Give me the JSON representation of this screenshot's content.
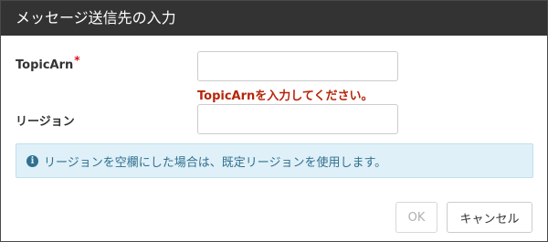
{
  "dialog": {
    "title": "メッセージ送信先の入力"
  },
  "form": {
    "topic_arn": {
      "label": "TopicArn",
      "required_mark": "*",
      "value": "",
      "error": "TopicArnを入力してください。"
    },
    "region": {
      "label": "リージョン",
      "value": ""
    }
  },
  "info": {
    "icon": "info-circle-icon",
    "message": "リージョンを空欄にした場合は、既定リージョンを使用します。"
  },
  "buttons": {
    "ok_label": "OK",
    "ok_disabled": true,
    "cancel_label": "キャンセル"
  },
  "colors": {
    "titlebar": "#333333",
    "error": "#b5260b",
    "required": "#e0101e",
    "info_bg": "#dff0f8",
    "info_text": "#31708f"
  }
}
